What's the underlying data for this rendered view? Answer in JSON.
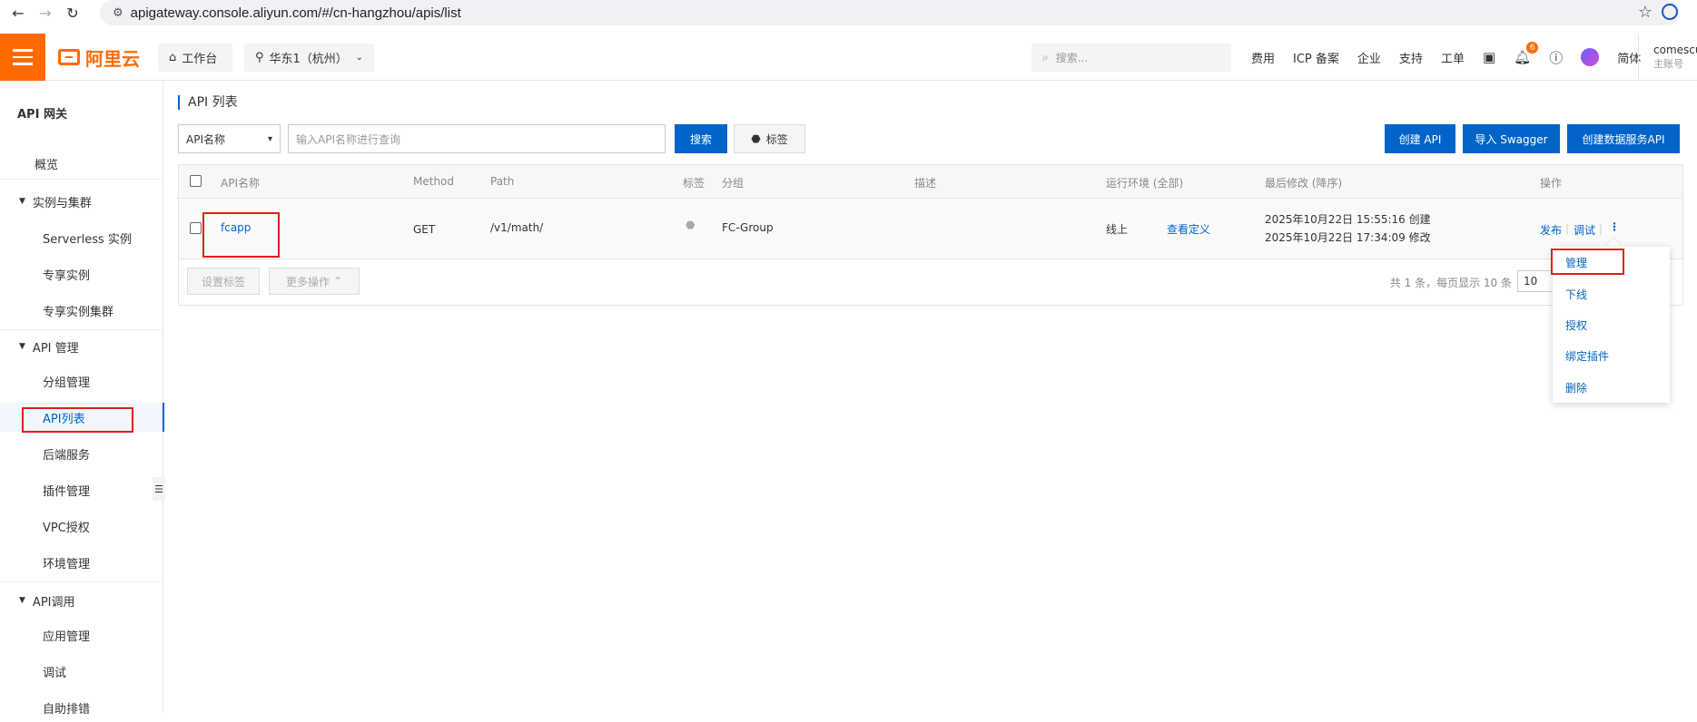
{
  "browser": {
    "url": "apigateway.console.aliyun.com/#/cn-hangzhou/apis/list"
  },
  "topnav": {
    "logo_text": "阿里云",
    "workbench": "工作台",
    "region": "华东1（杭州）",
    "search_placeholder": "搜索...",
    "links": [
      "费用",
      "ICP 备案",
      "企业",
      "支持",
      "工单"
    ],
    "notification_count": "6",
    "language": "简体",
    "username": "comescu",
    "account_type": "主账号"
  },
  "sidebar": {
    "title": "API 网关",
    "overview": "概览",
    "groups": [
      {
        "label": "实例与集群",
        "items": [
          "Serverless 实例",
          "专享实例",
          "专享实例集群"
        ]
      },
      {
        "label": "API 管理",
        "items": [
          "分组管理",
          "API列表",
          "后端服务",
          "插件管理",
          "VPC授权",
          "环境管理"
        ]
      },
      {
        "label": "API调用",
        "items": [
          "应用管理",
          "调试",
          "自助排错"
        ]
      }
    ]
  },
  "main": {
    "title": "API 列表",
    "filter_select": "API名称",
    "search_placeholder": "输入API名称进行查询",
    "search_button": "搜索",
    "tag_button": "标签",
    "create_api": "创建 API",
    "import_swagger": "导入 Swagger",
    "create_data_api": "创建数据服务API",
    "columns": {
      "name": "API名称",
      "method": "Method",
      "path": "Path",
      "tag": "标签",
      "group": "分组",
      "desc": "描述",
      "env": "运行环境 (全部)",
      "modified": "最后修改 (降序)",
      "actions": "操作"
    },
    "rows": [
      {
        "name": "fcapp",
        "method": "GET",
        "path": "/v1/math/",
        "group": "FC-Group",
        "env": "线上",
        "view_def": "查看定义",
        "created": "2025年10月22日 15:55:16 创建",
        "modified": "2025年10月22日 17:34:09 修改",
        "publish": "发布",
        "debug": "调试"
      }
    ],
    "footer": {
      "set_tag": "设置标签",
      "more_ops": "更多操作",
      "summary": "共 1 条，每页显示 10 条",
      "page_size": "10"
    },
    "dropdown": [
      "管理",
      "下线",
      "授权",
      "绑定插件",
      "删除"
    ]
  }
}
